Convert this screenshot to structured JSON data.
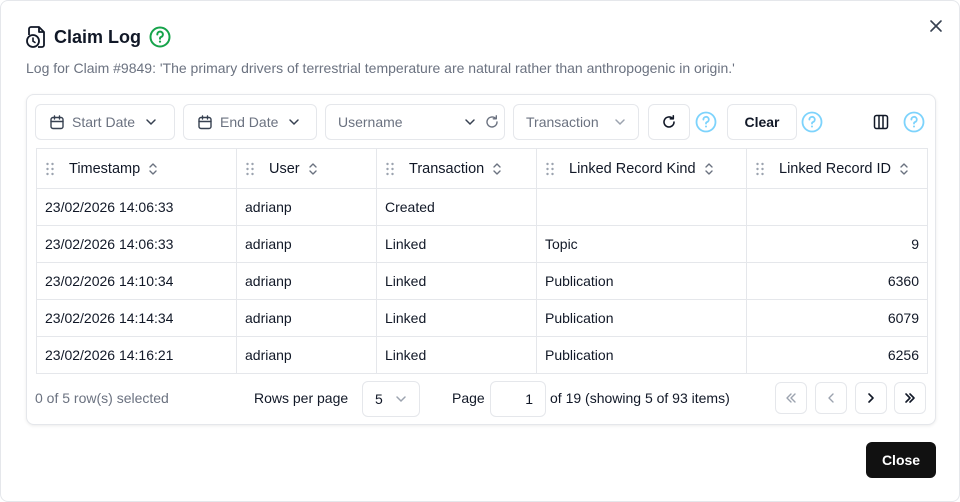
{
  "dialog": {
    "title": "Claim Log",
    "subtitle": "Log for Claim #9849: 'The primary drivers of terrestrial temperature are natural rather than anthropogenic in origin.'",
    "close_label": "Close",
    "icons": {
      "title": "file-clock-icon",
      "help": "question-circle-icon",
      "dismiss": "close-icon"
    },
    "colors": {
      "help_green": "#16a34a",
      "help_blue": "#7dd3fc",
      "primary_button": "#111111"
    }
  },
  "filters": {
    "start_date": "Start Date",
    "end_date": "End Date",
    "username_placeholder": "Username",
    "transaction": "Transaction",
    "clear": "Clear"
  },
  "table": {
    "headers": [
      "Timestamp",
      "User",
      "Transaction",
      "Linked Record Kind",
      "Linked Record ID"
    ],
    "rows": [
      [
        "23/02/2026 14:06:33",
        "adrianp",
        "Created",
        "",
        ""
      ],
      [
        "23/02/2026 14:06:33",
        "adrianp",
        "Linked",
        "Topic",
        "9"
      ],
      [
        "23/02/2026 14:10:34",
        "adrianp",
        "Linked",
        "Publication",
        "6360"
      ],
      [
        "23/02/2026 14:14:34",
        "adrianp",
        "Linked",
        "Publication",
        "6079"
      ],
      [
        "23/02/2026 14:16:21",
        "adrianp",
        "Linked",
        "Publication",
        "6256"
      ]
    ]
  },
  "footer": {
    "selection": "0 of 5 row(s) selected",
    "rows_per_page_label": "Rows per page",
    "rows_per_page_value": "5",
    "page_label": "Page",
    "page_value": "1",
    "page_summary": "of 19 (showing 5 of 93 items)"
  }
}
